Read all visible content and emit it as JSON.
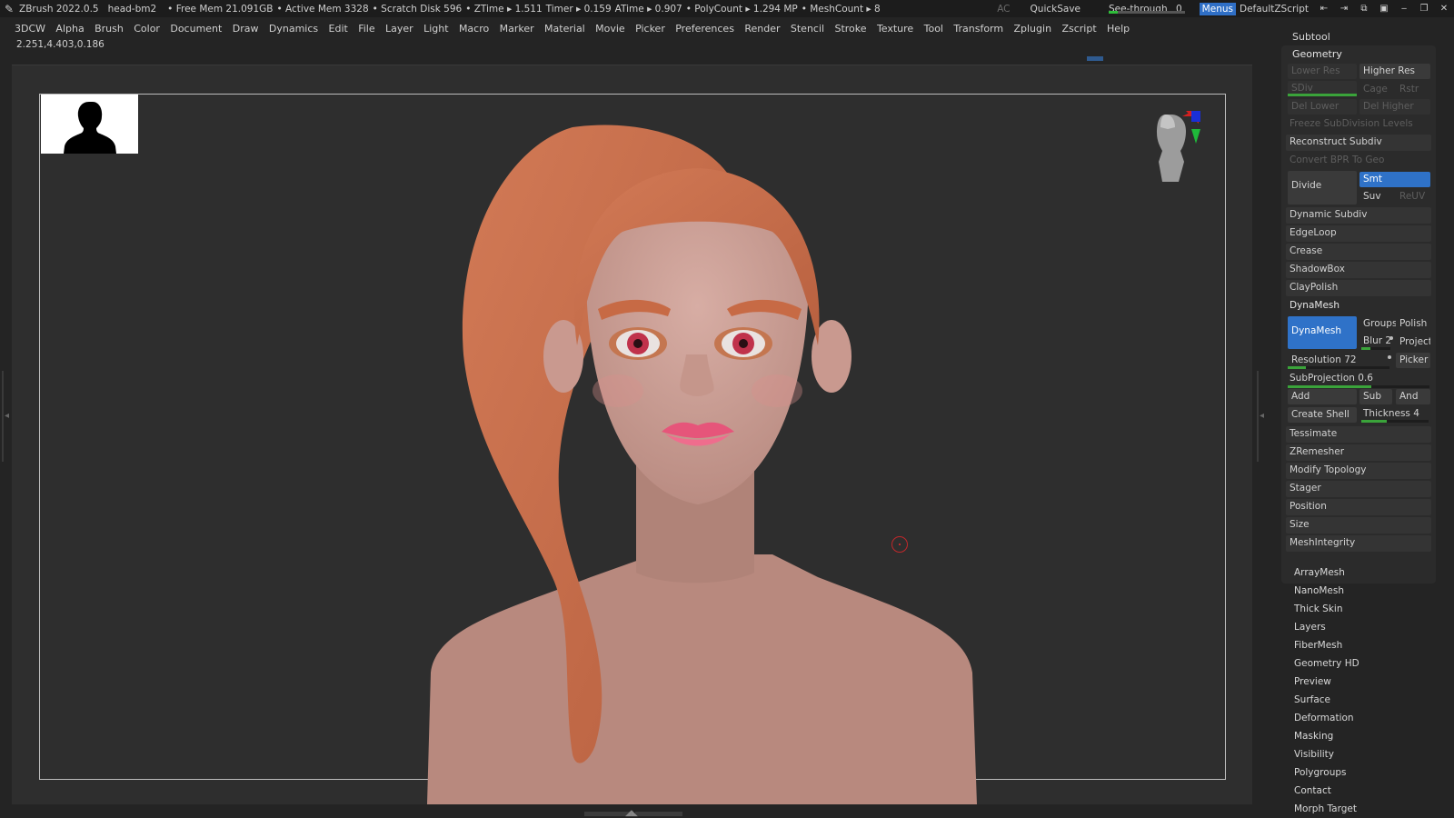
{
  "titlebar": {
    "app": "ZBrush 2022.0.5",
    "doc": "head-bm2",
    "free_mem": "• Free Mem 21.091GB",
    "active_mem": "• Active Mem 3328",
    "scratch": "• Scratch Disk 596",
    "ztime": "• ZTime ▸ 1.511",
    "timer": "Timer ▸ 0.159",
    "atime": "ATime ▸ 0.907",
    "polycount": "• PolyCount ▸ 1.294 MP",
    "meshcount": "• MeshCount ▸ 8",
    "ac": "AC",
    "quicksave": "QuickSave",
    "seethrough": "See-through",
    "seethrough_val": "0",
    "seethrough_frac": 0.12,
    "menus": "Menus",
    "defaultzscript": "DefaultZScript"
  },
  "menus": [
    "3DCW",
    "Alpha",
    "Brush",
    "Color",
    "Document",
    "Draw",
    "Dynamics",
    "Edit",
    "File",
    "Layer",
    "Light",
    "Macro",
    "Marker",
    "Material",
    "Movie",
    "Picker",
    "Preferences",
    "Render",
    "Stencil",
    "Stroke",
    "Texture",
    "Tool",
    "Transform",
    "Zplugin",
    "Zscript",
    "Help"
  ],
  "coords": "2.251,4.403,0.186",
  "panel": {
    "subtool": "Subtool",
    "geometry": "Geometry",
    "lower_res": "Lower Res",
    "higher_res": "Higher Res",
    "sdiv": "SDiv",
    "cage": "Cage",
    "rstr": "Rstr",
    "del_lower": "Del Lower",
    "del_higher": "Del Higher",
    "freeze": "Freeze SubDivision Levels",
    "reconstruct": "Reconstruct Subdiv",
    "convert_bpr": "Convert BPR To Geo",
    "divide": "Divide",
    "smt": "Smt",
    "suv": "Suv",
    "reuv": "ReUV",
    "sections": [
      "Dynamic Subdiv",
      "EdgeLoop",
      "Crease",
      "ShadowBox",
      "ClayPolish",
      "DynaMesh"
    ],
    "dynamesh_btn": "DynaMesh",
    "groups": "Groups",
    "polish": "Polish",
    "blur": "Blur 2",
    "project": "Project",
    "resolution": "Resolution 72",
    "picker": "Picker",
    "subprojection": "SubProjection 0.6",
    "add": "Add",
    "sub": "Sub",
    "and": "And",
    "create_shell": "Create Shell",
    "thickness": "Thickness 4",
    "sections2": [
      "Tessimate",
      "ZRemesher",
      "Modify Topology",
      "Stager",
      "Position",
      "Size",
      "MeshIntegrity"
    ],
    "tool_menus": [
      "ArrayMesh",
      "NanoMesh",
      "Thick Skin",
      "Layers",
      "FiberMesh",
      "Geometry HD",
      "Preview",
      "Surface",
      "Deformation",
      "Masking",
      "Visibility",
      "Polygroups",
      "Contact",
      "Morph Target"
    ]
  }
}
